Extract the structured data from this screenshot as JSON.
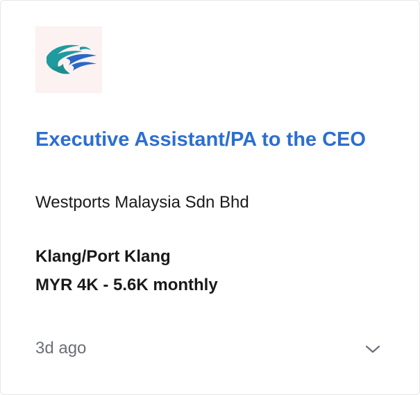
{
  "job": {
    "title": "Executive Assistant/PA to the CEO",
    "company": "Westports Malaysia Sdn Bhd",
    "location": "Klang/Port Klang",
    "salary": "MYR 4K - 5.6K monthly",
    "listed": "3d ago"
  },
  "icons": {
    "logo": "westports-logo",
    "expand": "chevron-down-icon"
  },
  "colors": {
    "title": "#2d6ed1",
    "logo_teal": "#1f9a9f",
    "logo_blue": "#2a67c7",
    "muted_text": "#6b6f76"
  }
}
